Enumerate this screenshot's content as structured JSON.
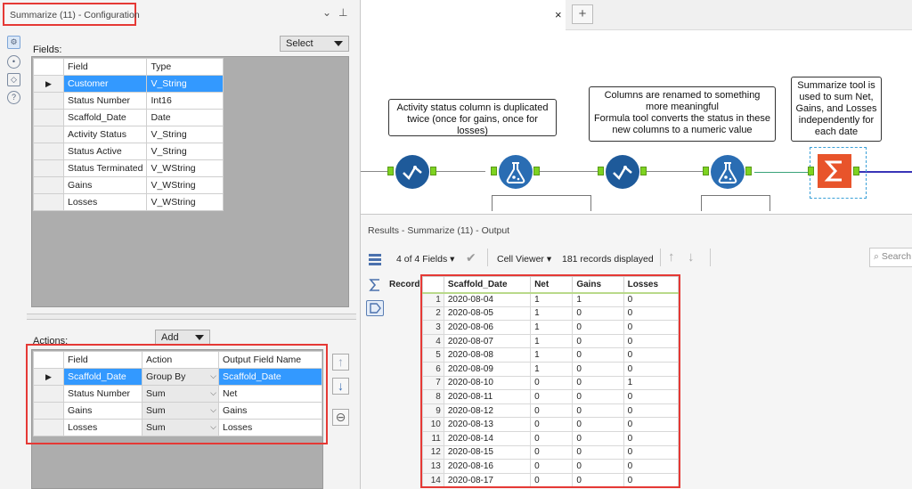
{
  "config": {
    "title": "Summarize (11) - Configuration",
    "fields_label": "Fields:",
    "select_label": "Select",
    "fields_header": [
      "Field",
      "Type"
    ],
    "fields": [
      {
        "field": "Customer",
        "type": "V_String"
      },
      {
        "field": "Status Number",
        "type": "Int16"
      },
      {
        "field": "Scaffold_Date",
        "type": "Date"
      },
      {
        "field": "Activity Status",
        "type": "V_String"
      },
      {
        "field": "Status Active",
        "type": "V_String"
      },
      {
        "field": "Status Terminated",
        "type": "V_WString"
      },
      {
        "field": "Gains",
        "type": "V_WString"
      },
      {
        "field": "Losses",
        "type": "V_WString"
      }
    ],
    "actions_label": "Actions:",
    "add_label": "Add",
    "actions_header": [
      "Field",
      "Action",
      "Output Field Name"
    ],
    "actions": [
      {
        "field": "Scaffold_Date",
        "action": "Group By",
        "output": "Scaffold_Date"
      },
      {
        "field": "Status Number",
        "action": "Sum",
        "output": "Net"
      },
      {
        "field": "Gains",
        "action": "Sum",
        "output": "Gains"
      },
      {
        "field": "Losses",
        "action": "Sum",
        "output": "Losses"
      }
    ]
  },
  "canvas": {
    "notes": [
      "Activity status column is duplicated twice (once for gains, once for losses)",
      "Columns are renamed to something more meaningful\nFormula tool converts the status in these new columns to a numeric value",
      "Summarize tool is used to sum Net, Gains, and Losses independently for each date"
    ],
    "tab_close": "×",
    "tab_add": "+"
  },
  "results": {
    "title": "Results - Summarize (11) - Output",
    "fields_count": "4 of 4 Fields",
    "cell_viewer": "Cell Viewer",
    "records_displayed": "181 records displayed",
    "search_placeholder": "Search",
    "record_label": "Record",
    "columns": [
      "Scaffold_Date",
      "Net",
      "Gains",
      "Losses"
    ],
    "rows": [
      [
        "1",
        "2020-08-04",
        "1",
        "1",
        "0"
      ],
      [
        "2",
        "2020-08-05",
        "1",
        "0",
        "0"
      ],
      [
        "3",
        "2020-08-06",
        "1",
        "0",
        "0"
      ],
      [
        "4",
        "2020-08-07",
        "1",
        "0",
        "0"
      ],
      [
        "5",
        "2020-08-08",
        "1",
        "0",
        "0"
      ],
      [
        "6",
        "2020-08-09",
        "1",
        "0",
        "0"
      ],
      [
        "7",
        "2020-08-10",
        "0",
        "0",
        "1"
      ],
      [
        "8",
        "2020-08-11",
        "0",
        "0",
        "0"
      ],
      [
        "9",
        "2020-08-12",
        "0",
        "0",
        "0"
      ],
      [
        "10",
        "2020-08-13",
        "0",
        "0",
        "0"
      ],
      [
        "11",
        "2020-08-14",
        "0",
        "0",
        "0"
      ],
      [
        "12",
        "2020-08-15",
        "0",
        "0",
        "0"
      ],
      [
        "13",
        "2020-08-16",
        "0",
        "0",
        "0"
      ],
      [
        "14",
        "2020-08-17",
        "0",
        "0",
        "0"
      ]
    ]
  },
  "colors": {
    "highlight": "#e53935",
    "selection": "#3399ff",
    "anchor": "#7ed321",
    "summarize": "#e8542b"
  }
}
